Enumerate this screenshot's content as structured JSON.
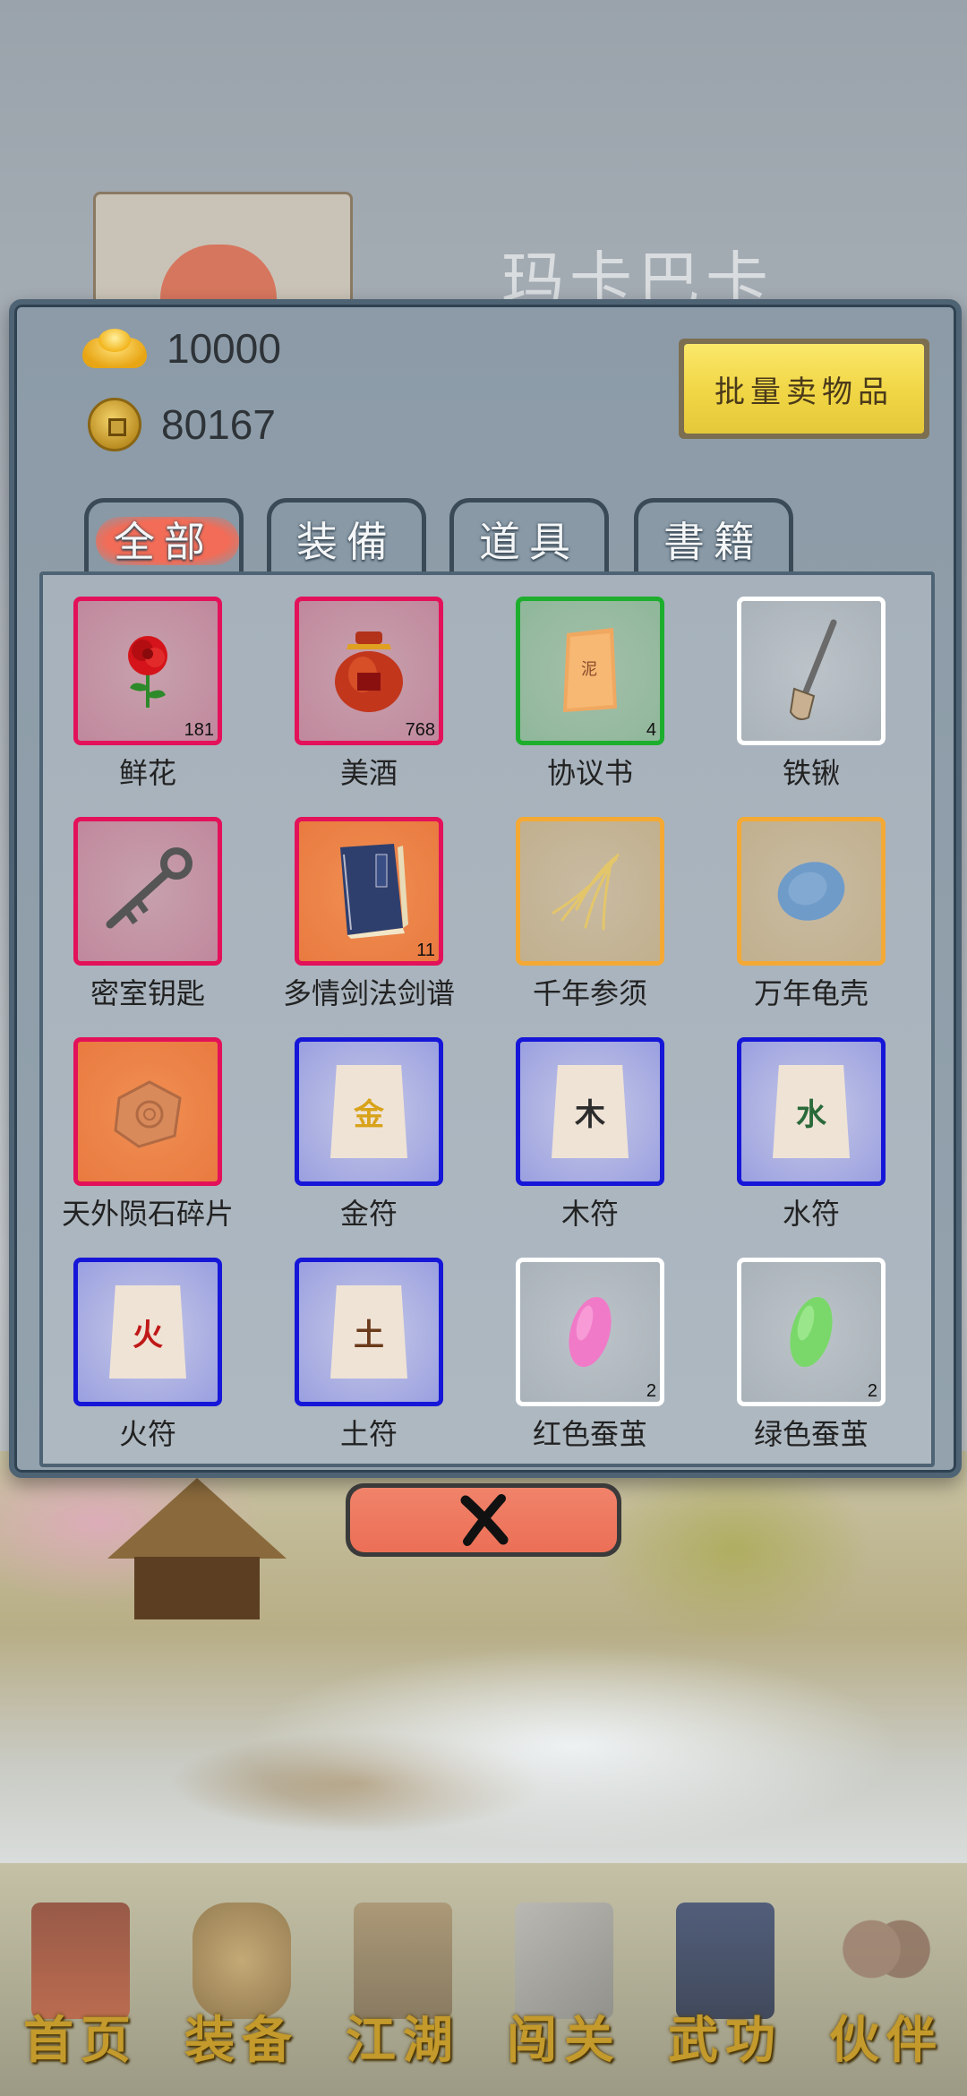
{
  "background": {
    "character_name": "玛卡巴卡"
  },
  "currency": {
    "gold_ingot": "10000",
    "copper_coin": "80167"
  },
  "sell_button_label": "批量卖物品",
  "tabs": [
    {
      "label": "全部",
      "active": true
    },
    {
      "label": "装備",
      "active": false
    },
    {
      "label": "道具",
      "active": false
    },
    {
      "label": "書籍",
      "active": false
    }
  ],
  "items": [
    {
      "name": "鲜花",
      "count": "181",
      "quality": "red",
      "icon": "rose-icon"
    },
    {
      "name": "美酒",
      "count": "768",
      "quality": "red",
      "icon": "wine-jar-icon"
    },
    {
      "name": "协议书",
      "count": "4",
      "quality": "green",
      "icon": "contract-icon"
    },
    {
      "name": "铁锹",
      "count": "",
      "quality": "white",
      "icon": "shovel-icon"
    },
    {
      "name": "密室钥匙",
      "count": "",
      "quality": "red",
      "icon": "key-icon"
    },
    {
      "name": "多情剑法剑谱",
      "count": "11",
      "quality": "orange-solid",
      "icon": "book-icon"
    },
    {
      "name": "千年参须",
      "count": "",
      "quality": "orange",
      "icon": "ginseng-icon"
    },
    {
      "name": "万年龟壳",
      "count": "",
      "quality": "orange",
      "icon": "turtle-shell-icon"
    },
    {
      "name": "天外陨石碎片",
      "count": "",
      "quality": "orange-solid",
      "icon": "meteorite-icon"
    },
    {
      "name": "金符",
      "count": "",
      "quality": "blue",
      "icon": "talisman-icon",
      "glyph": "金",
      "glyph_color": "#d8a21a"
    },
    {
      "name": "木符",
      "count": "",
      "quality": "blue",
      "icon": "talisman-icon",
      "glyph": "木",
      "glyph_color": "#2c2c2c"
    },
    {
      "name": "水符",
      "count": "",
      "quality": "blue",
      "icon": "talisman-icon",
      "glyph": "水",
      "glyph_color": "#2a6a3a"
    },
    {
      "name": "火符",
      "count": "",
      "quality": "blue",
      "icon": "talisman-icon",
      "glyph": "火",
      "glyph_color": "#c01818"
    },
    {
      "name": "土符",
      "count": "",
      "quality": "blue",
      "icon": "talisman-icon",
      "glyph": "土",
      "glyph_color": "#6a3a1a"
    },
    {
      "name": "红色蚕茧",
      "count": "2",
      "quality": "white",
      "icon": "pink-cocoon-icon"
    },
    {
      "name": "绿色蚕茧",
      "count": "2",
      "quality": "white",
      "icon": "green-cocoon-icon"
    }
  ],
  "bottom_nav": [
    {
      "label": "首页",
      "icon": "home-building-icon"
    },
    {
      "label": "装备",
      "icon": "armor-icon"
    },
    {
      "label": "江湖",
      "icon": "scroll-map-icon"
    },
    {
      "label": "闯关",
      "icon": "crossed-swords-icon"
    },
    {
      "label": "武功",
      "icon": "martial-book-icon"
    },
    {
      "label": "伙伴",
      "icon": "partners-icon"
    }
  ],
  "colors": {
    "quality_red": "#e3115a",
    "quality_green": "#1dae2e",
    "quality_white": "#ffffff",
    "quality_orange": "#f4a935",
    "quality_blue": "#1616d8",
    "accent_tab": "#f26c57",
    "sell_button": "#f0d544",
    "nav_text": "#c39a2b"
  }
}
